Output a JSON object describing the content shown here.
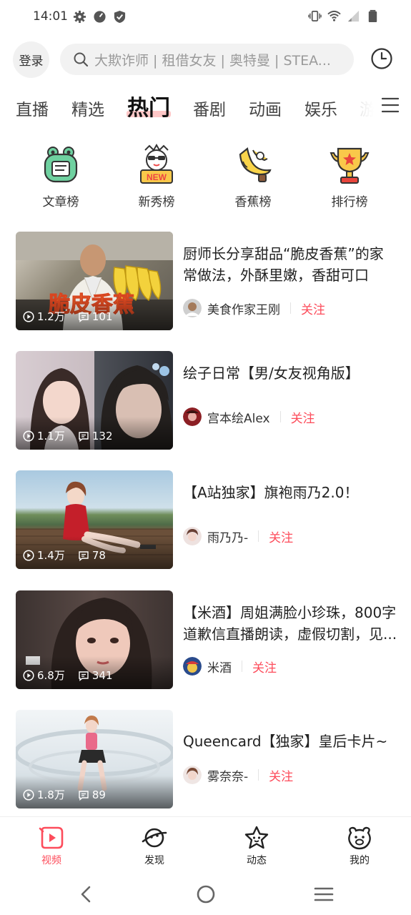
{
  "status_bar": {
    "time": "14:01",
    "left_icons": [
      "gear-icon",
      "speed-icon",
      "shield-icon"
    ],
    "right_icons": [
      "vibrate-icon",
      "wifi-icon",
      "signal-icon",
      "battery-icon"
    ]
  },
  "header": {
    "login_label": "登录",
    "search_placeholder": "大欺诈师 | 租借女友 | 奥特曼 | STEA...",
    "history_icon": "clock-icon"
  },
  "tabs": [
    {
      "label": "直播"
    },
    {
      "label": "精选"
    },
    {
      "label": "热门",
      "active": true
    },
    {
      "label": "番剧"
    },
    {
      "label": "动画"
    },
    {
      "label": "娱乐"
    },
    {
      "label": "游"
    }
  ],
  "quick_entries": [
    {
      "label": "文章榜",
      "icon": "frog-document-icon"
    },
    {
      "label": "新秀榜",
      "icon": "new-badge-icon"
    },
    {
      "label": "香蕉榜",
      "icon": "banana-icon"
    },
    {
      "label": "排行榜",
      "icon": "trophy-icon"
    }
  ],
  "feed": [
    {
      "title": "厨师长分享甜品“脆皮香蕉”的家常做法，外酥里嫩，香甜可口",
      "views": "1.2万",
      "comments": "101",
      "author": "美食作家王刚",
      "follow": "关注",
      "thumb_colors": [
        "#6d6a63",
        "#e8d35a"
      ]
    },
    {
      "title": "绘子日常【男/女友视角版】",
      "views": "1.1万",
      "comments": "132",
      "author": "宫本绘Alex",
      "follow": "关注",
      "thumb_colors": [
        "#c9b8b6",
        "#4c4e58"
      ]
    },
    {
      "title": "【A站独家】旗袍雨乃2.0！",
      "views": "1.4万",
      "comments": "78",
      "author": "雨乃乃-",
      "follow": "关注",
      "thumb_colors": [
        "#9cc0d8",
        "#8e6a4e"
      ]
    },
    {
      "title": "【米酒】周姐满脸小珍珠，800字道歉信直播朗读，虚假切割，见...",
      "views": "6.8万",
      "comments": "341",
      "author": "米酒",
      "follow": "关注",
      "thumb_colors": [
        "#4e3f3c",
        "#e0b6a8"
      ]
    },
    {
      "title": "Queencard【独家】皇后卡片~",
      "views": "1.8万",
      "comments": "89",
      "author": "雾奈奈-",
      "follow": "关注",
      "thumb_colors": [
        "#e9eef1",
        "#c7d3da"
      ]
    }
  ],
  "bottom_nav": [
    {
      "label": "视频",
      "icon": "video-icon",
      "active": true
    },
    {
      "label": "发现",
      "icon": "planet-icon"
    },
    {
      "label": "动态",
      "icon": "star-face-icon"
    },
    {
      "label": "我的",
      "icon": "bear-face-icon"
    }
  ],
  "system_nav": [
    "back-icon",
    "home-icon",
    "recents-icon"
  ],
  "colors": {
    "accent": "#fd4c5b",
    "follow": "#fd4c5b",
    "tab_underline": "#ffc7c7"
  }
}
